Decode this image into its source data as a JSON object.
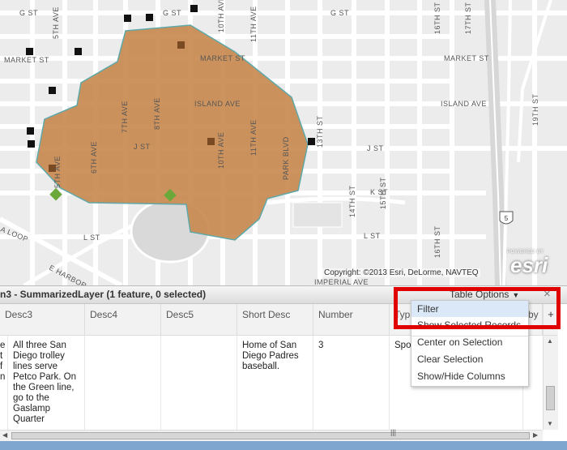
{
  "map": {
    "street_labels": {
      "g_st_left": "G ST",
      "g_st_mid": "G ST",
      "g_st_right": "G ST",
      "fifth_ave": "5TH AVE",
      "sixth_ave_top": "6TH AVE",
      "tenth_ave_top": "10TH AVE",
      "eleventh_ave_top": "11TH AVE",
      "market_st_left": "MARKET ST",
      "market_st_mid": "MARKET ST",
      "market_st_right": "MARKET ST",
      "island_ave_mid": "ISLAND AVE",
      "island_ave_right": "ISLAND AVE",
      "j_st_mid": "J ST",
      "j_st_right": "J ST",
      "k_st": "K ST",
      "l_st_left": "L ST",
      "l_st_right": "L ST",
      "sixth_ave_low": "6TH AVE",
      "seventh_ave": "7TH AVE",
      "eighth_ave": "8TH AVE",
      "tenth_ave_low": "10TH AVE",
      "eleventh_ave_low": "11TH AVE",
      "park_blvd": "PARK BLVD",
      "thirteenth_st": "13TH ST",
      "fourteenth_st": "14TH ST",
      "fifteenth_st": "15TH ST",
      "sixteenth_st": "16TH ST",
      "sixteenth_st_top": "16TH ST",
      "seventeenth_st_top": "17TH ST",
      "thirteenth_st_top": "13TH ST",
      "nineteenth_st": "19TH ST",
      "fifth_ave_left": "5TH AVE",
      "harbor": "E HARBOR",
      "loop": "A LOOP",
      "imperial_ave": "IMPERIAL AVE",
      "shield": "5"
    },
    "copyright": "Copyright: ©2013 Esri, DeLorme, NAVTEQ",
    "esri_powered": "POWERED BY",
    "esri_logo": "esri",
    "polygon_color": "#c8874d",
    "polygon_outline": "#5fa8a8"
  },
  "panel": {
    "layer_title": "n3 - SummarizedLayer (1 feature, 0 selected)",
    "table_options": "Table Options",
    "close": "×",
    "columns": [
      "Desc3",
      "Desc4",
      "Desc5",
      "Short Desc",
      "Number",
      "Typ",
      "by"
    ],
    "add_column": "+",
    "row": {
      "partial": "e\nt\nf\nn",
      "desc3": "All three San Diego trolley lines serve Petco Park. On the Green line, go to the Gaslamp Quarter",
      "desc4": "",
      "desc5": "",
      "short_desc": "Home of San Diego Padres baseball.",
      "number": "3",
      "type": "Spor"
    }
  },
  "menu": {
    "items": [
      "Filter",
      "Show Selected Records",
      "Center on Selection",
      "Clear Selection",
      "Show/Hide Columns"
    ]
  }
}
